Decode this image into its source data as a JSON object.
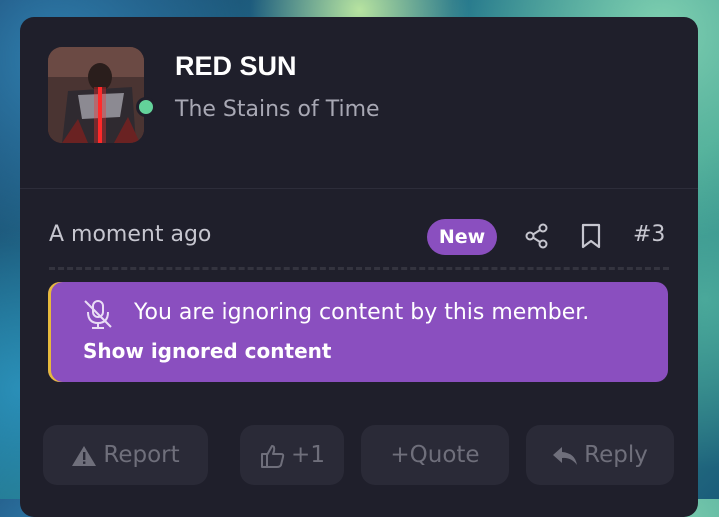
{
  "author": {
    "username": "RED SUN",
    "user_title": "The Stains of Time",
    "online": true
  },
  "post_meta": {
    "timestamp": "A moment ago",
    "badge": "New",
    "post_number": "#3"
  },
  "ignored_notice": {
    "message": "You are ignoring content by this member.",
    "link": "Show ignored content",
    "colors": {
      "background": "#8a4fbf",
      "accent_bar": "#e6b93d"
    }
  },
  "actions": {
    "report": "Report",
    "like": "+1",
    "quote": "+Quote",
    "reply": "Reply"
  },
  "icons": [
    "share-icon",
    "bookmark-icon",
    "mute-icon",
    "warning-icon",
    "thumbs-up-icon",
    "reply-icon"
  ],
  "colors": {
    "card_bg": "#1f1f2b",
    "online": "#63d29a",
    "new_badge": "#8a4fbf"
  }
}
